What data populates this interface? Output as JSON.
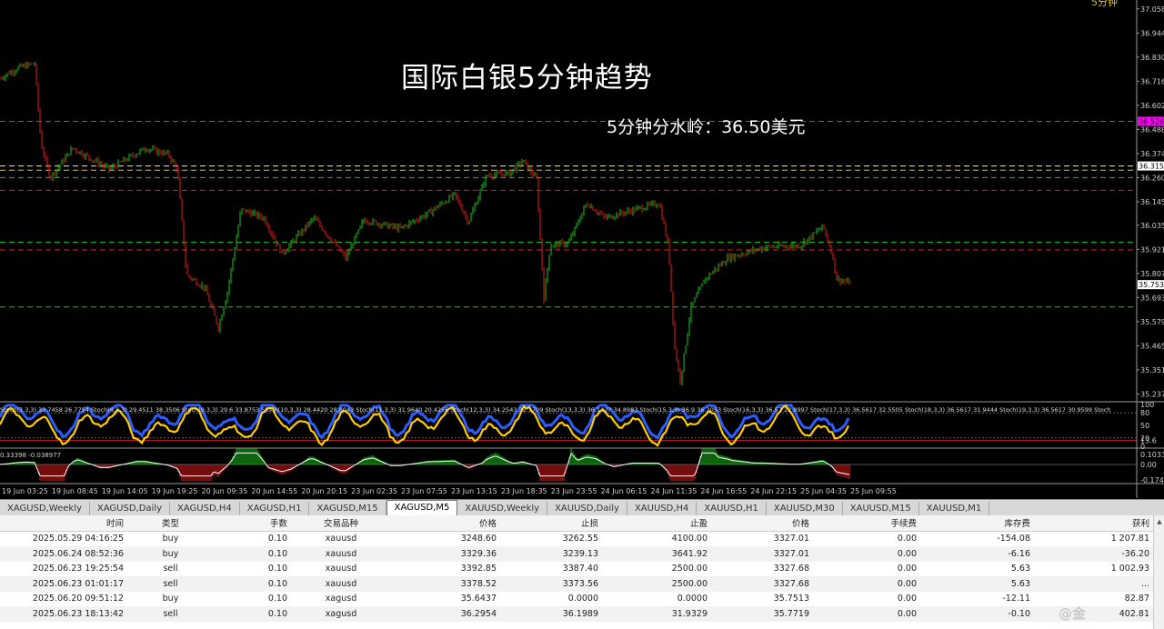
{
  "chart": {
    "title": "国际白银5分钟趋势",
    "annotation": "5分钟分水岭：36.50美元",
    "corner_label": "5分钟",
    "price_ticks": [
      "37.0580",
      "36.9440",
      "36.8300",
      "36.7160",
      "36.6020",
      "36.4880",
      "36.3740",
      "36.2600",
      "36.1450",
      "36.0350",
      "35.9210",
      "35.8070",
      "35.6930",
      "35.5790",
      "35.4650",
      "35.3510",
      "35.2370"
    ],
    "marker_magenta": "36.5263",
    "marker_white": "36.3151",
    "marker_current": "35.7538",
    "osc_ticks": [
      "100",
      "80",
      "50",
      "20",
      "13.6",
      "0"
    ],
    "osc_legend": "Stoch(3,3,3) 33.7458 26.7754  Stoch(8,3,3) 29.4511 38.3506  Stoch(9,3,3) 29.6 33.8753  Stoch(10,3,3) 28.4420 28.8043  Stoch(11,3,3) 31.9640 20.4256  Stoch(12,3,3) 34.2543 32.1709  Stoch(13,3,3) 36.1427 34.8983  Stoch(15,3,3) 36.9 36.2053  Stoch(16,3,3) 36.57 22.8997  Stoch(17,3,3) 36.5617 32.5505  Stoch(18,3,3) 36.5617 31.9444  Stoch(19,3,3) 36.5617 30.9599  Stoch",
    "macd_ticks": [
      "0.103309",
      "0.00",
      "-0.17489"
    ],
    "macd_label": "0.33398 -0.038977",
    "time_labels": [
      "19 Jun 03:25",
      "19 Jun 08:45",
      "19 Jun 14:05",
      "19 Jun 19:25",
      "20 Jun 09:35",
      "20 Jun 14:55",
      "20 Jun 20:15",
      "23 Jun 02:35",
      "23 Jun 07:55",
      "23 Jun 13:15",
      "23 Jun 18:35",
      "23 Jun 23:55",
      "24 Jun 06:15",
      "24 Jun 11:35",
      "24 Jun 16:55",
      "24 Jun 22:15",
      "25 Jun 04:35",
      "25 Jun 09:55"
    ],
    "colors": {
      "bull": "#19c819",
      "bear": "#e81d1d",
      "magenta": "#ff00ff",
      "stoch": "#ffcc00",
      "stoch_fill": "#2b5cff"
    },
    "price_range": [
      35.2,
      37.1
    ]
  },
  "tabs": [
    {
      "label": "XAGUSD,Weekly"
    },
    {
      "label": "XAGUSD,Daily"
    },
    {
      "label": "XAGUSD,H4"
    },
    {
      "label": "XAGUSD,H1"
    },
    {
      "label": "XAGUSD,M15"
    },
    {
      "label": "XAGUSD,M5"
    },
    {
      "label": "XAUUSD,Weekly"
    },
    {
      "label": "XAUUSD,Daily"
    },
    {
      "label": "XAUUSD,H4"
    },
    {
      "label": "XAUUSD,H1"
    },
    {
      "label": "XAUUSD,M30"
    },
    {
      "label": "XAUUSD,M15"
    },
    {
      "label": "XAUUSD,M1"
    }
  ],
  "active_tab": "XAGUSD,M5",
  "orders": {
    "headers": [
      "时间",
      "类型",
      "手数",
      "交易品种",
      "价格",
      "止损",
      "止盈",
      "价格",
      "手续费",
      "库存费",
      "获利"
    ],
    "rows": [
      [
        "2025.05.29 04:16:25",
        "buy",
        "0.10",
        "xauusd",
        "3248.60",
        "3262.55",
        "4100.00",
        "3327.01",
        "0.00",
        "-154.08",
        "1 207.81"
      ],
      [
        "2025.06.24 08:52:36",
        "buy",
        "0.10",
        "xauusd",
        "3329.36",
        "3239.13",
        "3641.92",
        "3327.01",
        "0.00",
        "-6.16",
        "-36.20"
      ],
      [
        "2025.06.23 19:25:54",
        "sell",
        "0.10",
        "xauusd",
        "3392.85",
        "3387.40",
        "2500.00",
        "3327.68",
        "0.00",
        "5.63",
        "1 002.93"
      ],
      [
        "2025.06.23 01:01:17",
        "sell",
        "0.10",
        "xauusd",
        "3378.52",
        "3373.56",
        "2500.00",
        "3327.68",
        "0.00",
        "5.63",
        "..."
      ],
      [
        "2025.06.20 09:51:12",
        "buy",
        "0.10",
        "xagusd",
        "35.6437",
        "0.0000",
        "0.0000",
        "35.7513",
        "0.00",
        "-12.11",
        "82.87"
      ],
      [
        "2025.06.23 18:13:42",
        "sell",
        "0.10",
        "xagusd",
        "36.2954",
        "36.1989",
        "31.9329",
        "35.7719",
        "0.00",
        "-0.10",
        "402.81"
      ]
    ]
  },
  "watermark": "@金"
}
